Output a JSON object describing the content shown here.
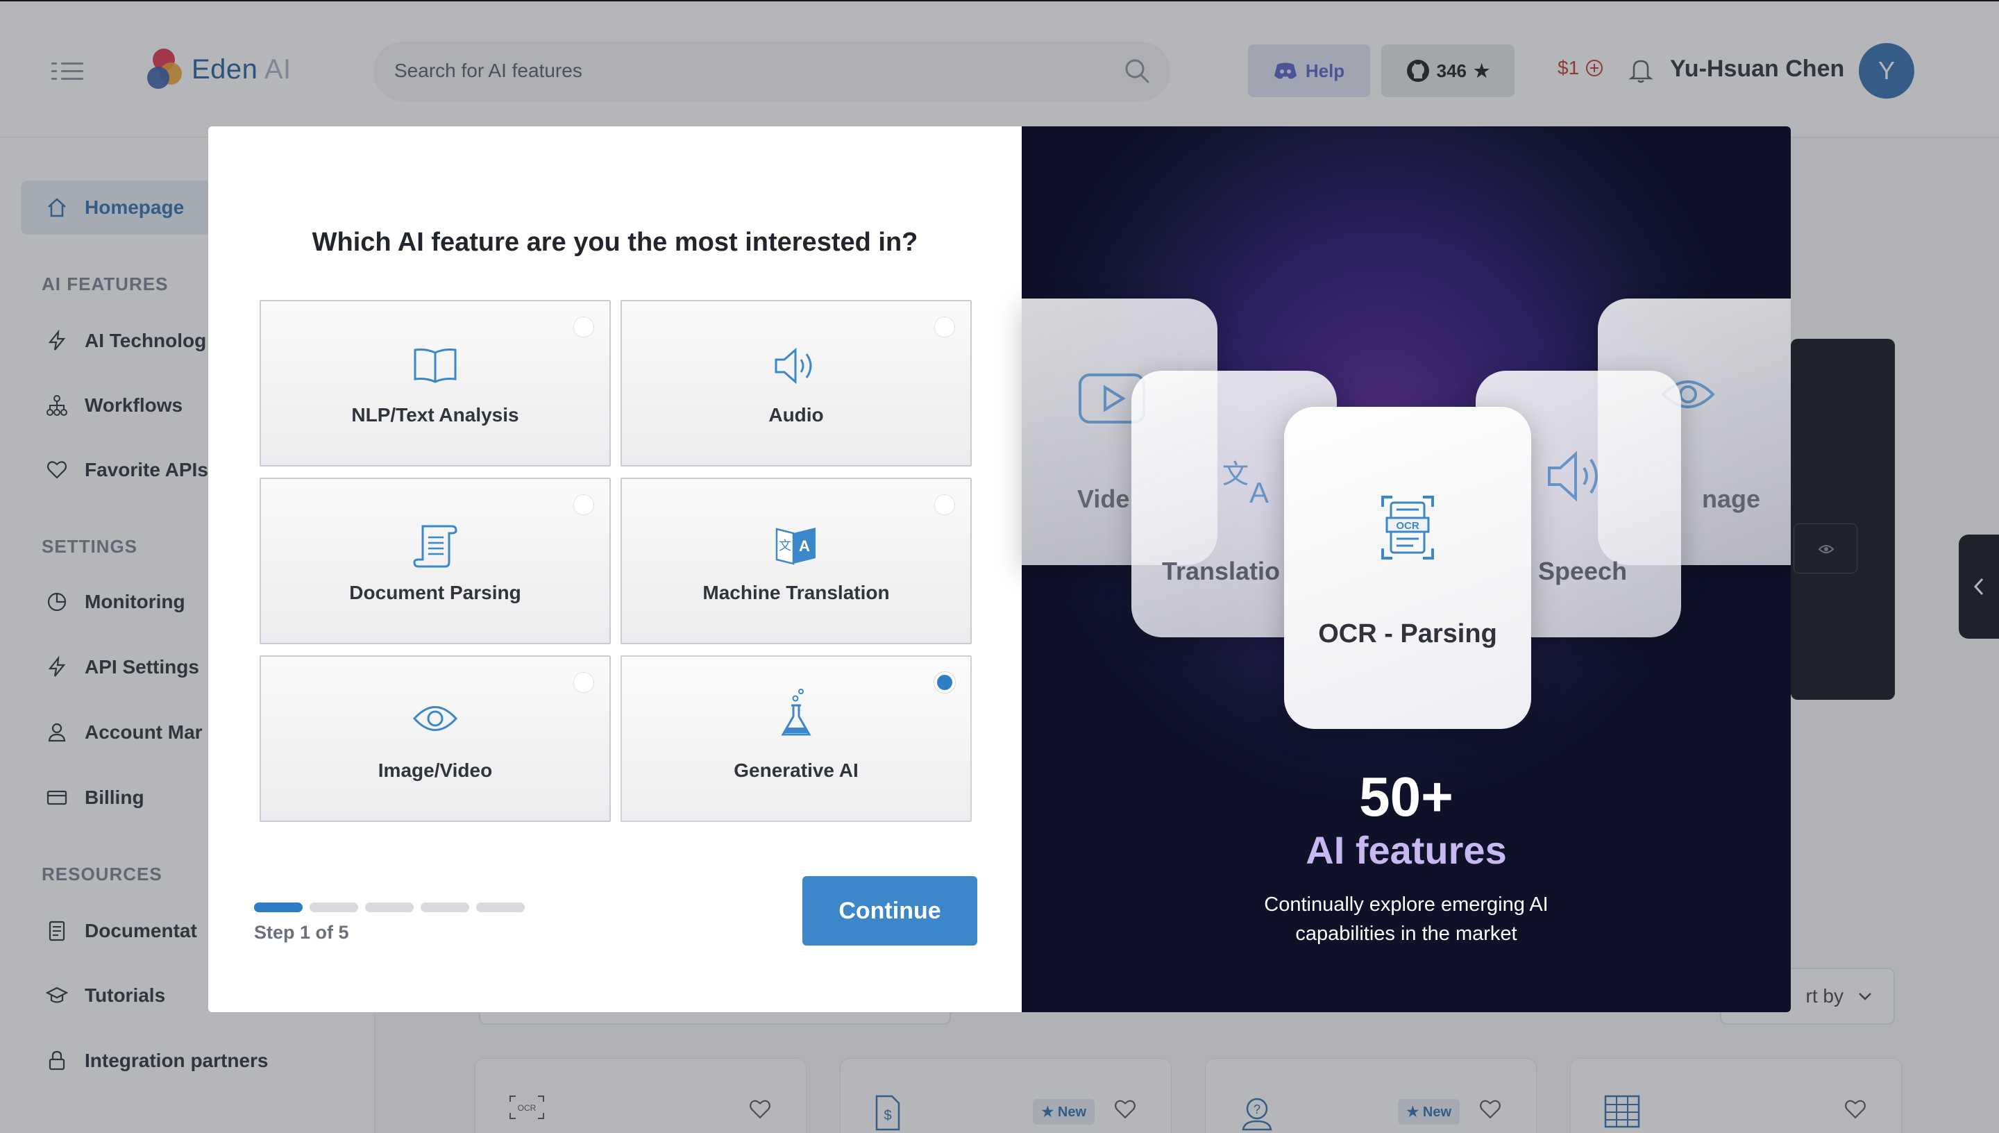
{
  "header": {
    "logo_name": "Eden",
    "logo_suffix": "AI",
    "search_placeholder": "Search for AI features",
    "help_label": "Help",
    "github_stars": "346",
    "credit": "$1",
    "user_name": "Yu-Hsuan Chen",
    "avatar_initial": "Y"
  },
  "sidebar": {
    "homepage": "Homepage",
    "sections": {
      "ai_features": "AI FEATURES",
      "settings": "SETTINGS",
      "resources": "RESOURCES"
    },
    "items": {
      "ai_technologies": "AI Technolog",
      "workflows": "Workflows",
      "favorite_apis": "Favorite APIs",
      "monitoring": "Monitoring",
      "api_settings": "API Settings",
      "account_management": "Account Mar",
      "billing": "Billing",
      "documentation": "Documentat",
      "tutorials": "Tutorials",
      "integration_partners": "Integration partners"
    }
  },
  "background": {
    "sort_label": "rt by",
    "new_badge": "New"
  },
  "modal": {
    "question": "Which AI feature are you the most interested in?",
    "options": [
      {
        "label": "NLP/Text Analysis",
        "icon": "book-icon",
        "selected": false
      },
      {
        "label": "Audio",
        "icon": "speaker-icon",
        "selected": false
      },
      {
        "label": "Document Parsing",
        "icon": "scroll-document-icon",
        "selected": false
      },
      {
        "label": "Machine Translation",
        "icon": "translate-icon",
        "selected": false
      },
      {
        "label": "Image/Video",
        "icon": "eye-icon",
        "selected": false
      },
      {
        "label": "Generative AI",
        "icon": "flask-icon",
        "selected": true
      }
    ],
    "step_text": "Step 1 of 5",
    "current_step": 1,
    "total_steps": 5,
    "continue_label": "Continue",
    "feature_cards": {
      "video": "Vide",
      "translation": "Translatio",
      "ocr": "OCR - Parsing",
      "speech": "Speech",
      "image": "nage"
    },
    "headline_number": "50+",
    "headline_text": "AI features",
    "subtext_line1": "Continually explore emerging AI",
    "subtext_line2": "capabilities in the market"
  },
  "colors": {
    "accent": "#2d7ec7",
    "brand": "#1f5f9e",
    "feature_purple": "#c8b8f2",
    "credit_red": "#c0392b"
  }
}
